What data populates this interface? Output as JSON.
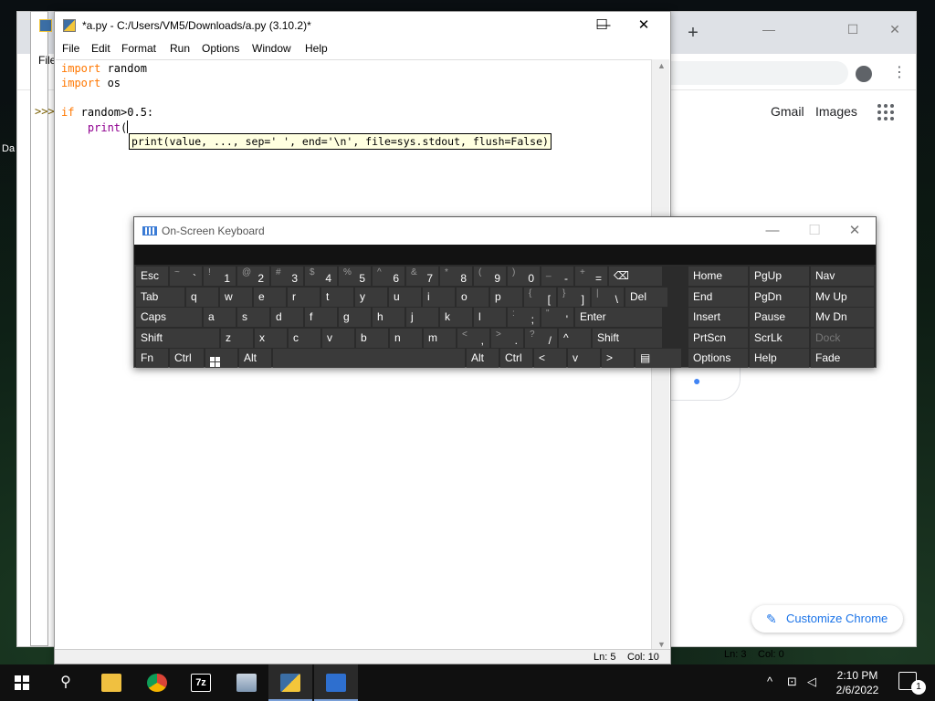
{
  "desktop": {
    "partial_label": "Da"
  },
  "chrome": {
    "new_tab": "+",
    "menu_icon": "⋮",
    "gmail": "Gmail",
    "images": "Images",
    "customize_label": "Customize Chrome",
    "status_ln": "Ln: 3",
    "status_col": "Col: 0"
  },
  "shell": {
    "menu_file": "File",
    "prompt": ">>>"
  },
  "editor": {
    "title": "*a.py - C:/Users/VM5/Downloads/a.py (3.10.2)*",
    "controls": {
      "minimize": "—",
      "maximize": "☐",
      "close": "✕"
    },
    "menu": [
      "File",
      "Edit",
      "Format",
      "Run",
      "Options",
      "Window",
      "Help"
    ],
    "code": {
      "l1_kw": "import",
      "l1_rest": " random",
      "l2_kw": "import",
      "l2_rest": " os",
      "l4_kw": "if",
      "l4_rest": " random>0.5:",
      "l5_indent": "    ",
      "l5_fn": "print",
      "l5_paren": "("
    },
    "calltip": "print(value, ..., sep=' ', end='\\n', file=sys.stdout, flush=False)",
    "status_ln": "Ln: 5",
    "status_col": "Col: 10"
  },
  "osk": {
    "title": "On-Screen Keyboard",
    "controls": {
      "minimize": "—",
      "maximize": "☐",
      "close": "✕"
    },
    "row1": [
      {
        "main": "Esc"
      },
      {
        "sub": "~",
        "main": "`"
      },
      {
        "sub": "!",
        "main": "1"
      },
      {
        "sub": "@",
        "main": "2"
      },
      {
        "sub": "#",
        "main": "3"
      },
      {
        "sub": "$",
        "main": "4"
      },
      {
        "sub": "%",
        "main": "5"
      },
      {
        "sub": "^",
        "main": "6"
      },
      {
        "sub": "&",
        "main": "7"
      },
      {
        "sub": "*",
        "main": "8"
      },
      {
        "sub": "(",
        "main": "9"
      },
      {
        "sub": ")",
        "main": "0"
      },
      {
        "sub": "_",
        "main": "-"
      },
      {
        "sub": "+",
        "main": "="
      },
      {
        "main": "⌫"
      }
    ],
    "row2": [
      "Tab",
      "q",
      "w",
      "e",
      "r",
      "t",
      "y",
      "u",
      "i",
      "o",
      "p",
      "[",
      "]",
      "\\",
      "Del"
    ],
    "row2_subs": {
      "lbrace": "{",
      "rbrace": "}",
      "pipe": "|"
    },
    "row3": [
      "Caps",
      "a",
      "s",
      "d",
      "f",
      "g",
      "h",
      "j",
      "k",
      "l",
      ";",
      "'",
      "Enter"
    ],
    "row3_subs": {
      "colon": ":",
      "quote": "\""
    },
    "row4": [
      "Shift",
      "z",
      "x",
      "c",
      "v",
      "b",
      "n",
      "m",
      ",",
      ".",
      "/",
      "^",
      "Shift"
    ],
    "row4_subs": {
      "lt": "<",
      "gt": ">",
      "question": "?"
    },
    "row5": [
      "Fn",
      "Ctrl",
      "Alt",
      "Alt",
      "Ctrl",
      "<",
      "v",
      ">"
    ],
    "right_pane": [
      [
        "Home",
        "PgUp",
        "Nav"
      ],
      [
        "End",
        "PgDn",
        "Mv Up"
      ],
      [
        "Insert",
        "Pause",
        "Mv Dn"
      ],
      [
        "PrtScn",
        "ScrLk",
        "Dock"
      ],
      [
        "Options",
        "Help",
        "Fade"
      ]
    ]
  },
  "taskbar": {
    "time": "2:10 PM",
    "date": "2/6/2022",
    "apps": [
      "start-button",
      "search",
      "file-explorer",
      "chrome",
      "7zip",
      "control-panel",
      "idle",
      "remote-desktop"
    ],
    "notification_count": "1",
    "icon_7z": "7z"
  },
  "colors": {
    "keyword": "#ff7700",
    "builtin": "#900090",
    "calltip_bg": "#ffffe0",
    "osk_key": "#3a3a3a",
    "chrome_blue": "#1a73e8"
  }
}
